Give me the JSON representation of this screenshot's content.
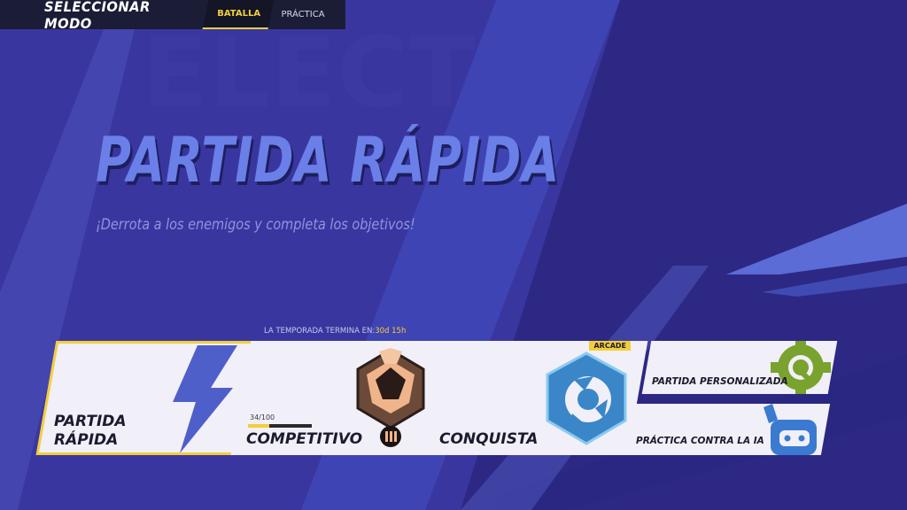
{
  "header": {
    "title": "SELECCIONAR MODO",
    "tabs": [
      {
        "label": "BATALLA",
        "active": true
      },
      {
        "label": "PRÁCTICA",
        "active": false
      }
    ]
  },
  "hero": {
    "title": "PARTIDA RÁPIDA",
    "subtitle": "¡Derrota a los enemigos y completa los objetivos!"
  },
  "season": {
    "label": "LA TEMPORADA TERMINA EN:",
    "time": "30d 15h"
  },
  "modes": [
    {
      "line1": "PARTIDA",
      "line2": "RÁPIDA",
      "icon": "lightning-icon",
      "selected": true
    },
    {
      "label": "COMPETITIVO",
      "icon": "rank-emblem-icon",
      "progress": "34/100",
      "progress_fraction": 0.34
    },
    {
      "label": "CONQUISTA",
      "icon": "conquest-hexagon-icon",
      "badge": "ARCADE"
    },
    {
      "label": "PARTIDA PERSONALIZADA",
      "icon": "custom-gear-icon"
    },
    {
      "label": "PRÁCTICA CONTRA LA IA",
      "icon": "robot-icon"
    }
  ],
  "colors": {
    "accent": "#f2cf3a",
    "background": "#2e2a86",
    "hero_text": "#6b7fe8",
    "card": "#f1eff7"
  }
}
